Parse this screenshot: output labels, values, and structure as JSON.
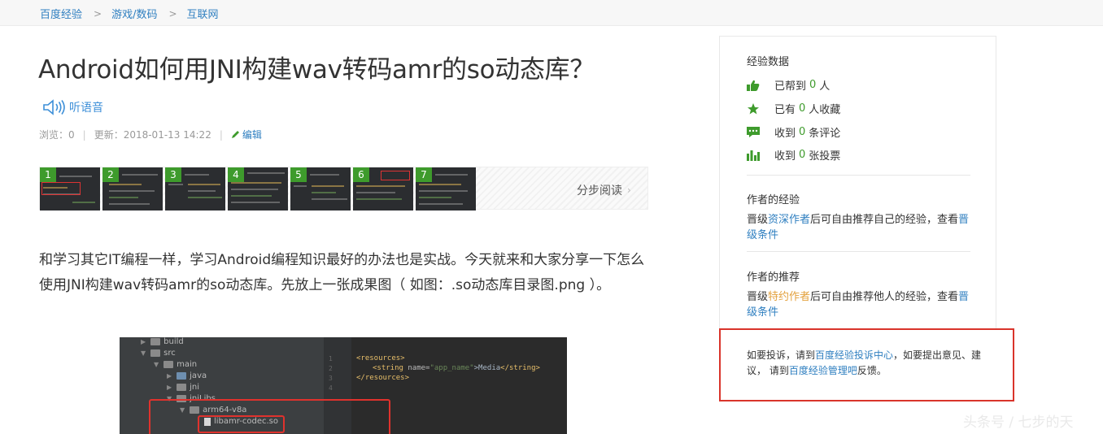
{
  "breadcrumb": {
    "items": [
      "百度经验",
      "游戏/数码",
      "互联网"
    ],
    "separator": ">"
  },
  "article": {
    "title": "Android如何用JNI构建wav转码amr的so动态库？",
    "listen_label": "听语音",
    "meta": {
      "views": "浏览：0",
      "updated": "更新：2018-01-13 14:22",
      "edit": "编辑"
    },
    "steps": {
      "numbers": [
        "1",
        "2",
        "3",
        "4",
        "5",
        "6",
        "7"
      ],
      "read_label": "分步阅读",
      "arrow": "›"
    },
    "intro": "和学习其它IT编程一样，学习Android编程知识最好的办法也是实战。今天就来和大家分享一下怎么使用JNI构建wav转码amr的so动态库。先放上一张成果图（ 如图：.so动态库目录图.png ）。",
    "code_image": {
      "tree": [
        "build",
        "src",
        "main",
        "java",
        "jni",
        "jniLibs",
        "arm64-v8a",
        "libamr-codec.so"
      ],
      "gutter": [
        "1",
        "2",
        "3",
        "4"
      ],
      "code": {
        "l1": "<resources>",
        "l2_tag_open": "<string ",
        "l2_attr": "name=",
        "l2_val": "\"app_name\"",
        "l2_text": ">Media",
        "l2_close": "</string>",
        "l3": "</resources>"
      }
    }
  },
  "sidebar": {
    "data_title": "经验数据",
    "stats": [
      {
        "icon": "thumbs-up-icon",
        "pre": "已帮到",
        "num": "0",
        "post": "人"
      },
      {
        "icon": "star-icon",
        "pre": "已有",
        "num": "0",
        "post": "人收藏"
      },
      {
        "icon": "comment-icon",
        "pre": "收到",
        "num": "0",
        "post": "条评论"
      },
      {
        "icon": "bar-chart-icon",
        "pre": "收到",
        "num": "0",
        "post": "张投票"
      }
    ],
    "author_exp": {
      "title": "作者的经验",
      "pre": "晋级",
      "link": "资深作者",
      "mid": "后可自由推荐自己的经验，查看",
      "link2": "晋级条件"
    },
    "author_rec": {
      "title": "作者的推荐",
      "pre": "晋级",
      "link": "特约作者",
      "mid": "后可自由推荐他人的经验，查看",
      "link2": "晋级条件"
    },
    "complain": {
      "pre": "如要投诉，请到",
      "link1": "百度经验投诉中心",
      "mid": "，如要提出意见、建议， 请到",
      "link2": "百度经验管理吧",
      "post": "反馈。"
    }
  },
  "watermark": "头条号 / 七步的天",
  "colors": {
    "link": "#2f7fc0",
    "green": "#3e9b2c",
    "highlight_red": "#d9342b",
    "orange_link": "#e3a13d"
  }
}
